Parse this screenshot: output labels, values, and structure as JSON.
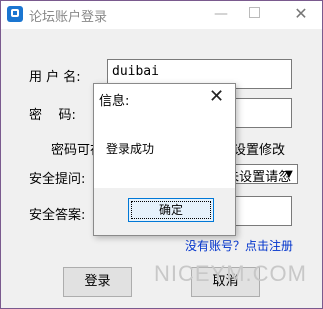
{
  "window": {
    "title": "论坛账户登录",
    "minimize": "—",
    "close": "✕"
  },
  "form": {
    "username_label": "用 户 名:",
    "username_value": "duibai",
    "password_label": "密    码:",
    "hint_left": "密码可在",
    "hint_right": "设置修改",
    "question_label": "安全提问:",
    "question_value": "(未设置请忽略)",
    "answer_label": "安全答案:",
    "register_link": "没有账号？点击注册",
    "login_button": "登录",
    "cancel_button": "取消"
  },
  "watermark": "NICEYM.COM",
  "dialog": {
    "title": "信息:",
    "close": "✕",
    "message": "登录成功",
    "ok_button": "确定"
  }
}
